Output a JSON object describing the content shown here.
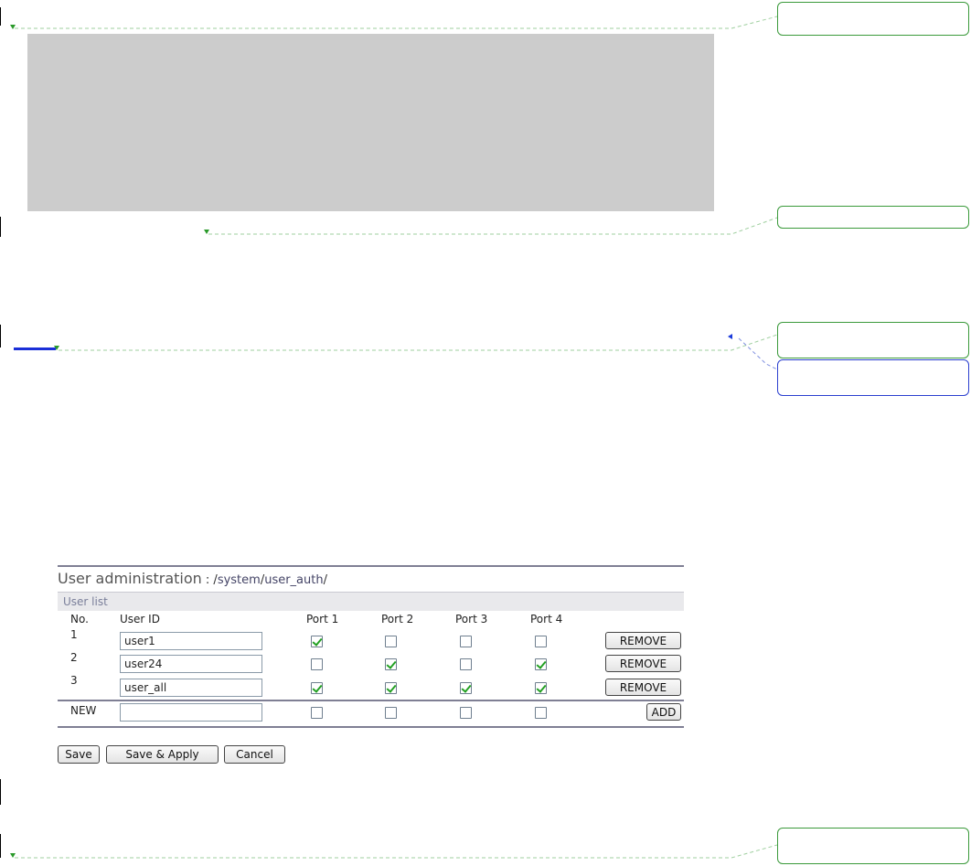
{
  "panel": {
    "title": "User administration",
    "path_prefix": " : /",
    "path_system": "system",
    "path_slash1": "/",
    "path_user_auth": "user_auth",
    "path_slash2": "/",
    "subheading": "User list"
  },
  "table": {
    "headers": [
      "No.",
      "User ID",
      "Port 1",
      "Port 2",
      "Port 3",
      "Port 4"
    ],
    "rows": [
      {
        "no": "1",
        "user_id": "user1",
        "ports": [
          true,
          false,
          false,
          false
        ],
        "action": "REMOVE"
      },
      {
        "no": "2",
        "user_id": "user24",
        "ports": [
          false,
          true,
          false,
          true
        ],
        "action": "REMOVE"
      },
      {
        "no": "3",
        "user_id": "user_all",
        "ports": [
          true,
          true,
          true,
          true
        ],
        "action": "REMOVE"
      }
    ],
    "new_row": {
      "label": "NEW",
      "user_id": "",
      "ports": [
        false,
        false,
        false,
        false
      ],
      "action": "ADD"
    }
  },
  "buttons": {
    "save": "Save",
    "save_apply": "Save & Apply",
    "cancel": "Cancel"
  },
  "colors": {
    "annotation_green": "#3b9a3b",
    "annotation_blue": "#2b3fcf",
    "panel_rule": "#7f7f94",
    "check_green": "#23a123",
    "placeholder_gray": "#cccccc"
  }
}
